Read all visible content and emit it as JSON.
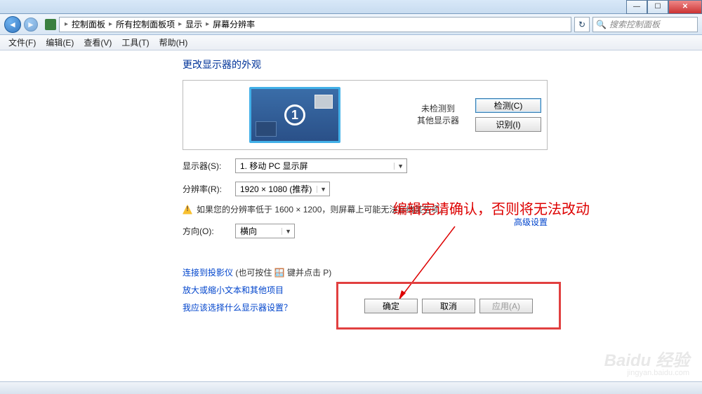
{
  "window": {
    "min_icon": "—",
    "max_icon": "☐",
    "close_icon": "✕"
  },
  "breadcrumb": {
    "items": [
      "控制面板",
      "所有控制面板项",
      "显示",
      "屏幕分辨率"
    ]
  },
  "search": {
    "placeholder": "搜索控制面板"
  },
  "menu": {
    "file": "文件(F)",
    "edit": "编辑(E)",
    "view": "查看(V)",
    "tools": "工具(T)",
    "help": "帮助(H)"
  },
  "page": {
    "heading": "更改显示器的外观",
    "monitor_number": "1",
    "not_detected_line1": "未检测到",
    "not_detected_line2": "其他显示器",
    "detect_btn": "检测(C)",
    "identify_btn": "识别(I)",
    "display_label": "显示器(S):",
    "display_value": "1. 移动 PC 显示屏",
    "resolution_label": "分辨率(R):",
    "resolution_value": "1920 × 1080 (推荐)",
    "warning_text": "如果您的分辨率低于 1600 × 1200，则屏幕上可能无法容纳某些项。",
    "orientation_label": "方向(O):",
    "orientation_value": "横向",
    "advanced_link": "高级设置",
    "projector_link": "连接到投影仪",
    "projector_paren": " (也可按住 🪟 键并点击 P)",
    "zoom_link": "放大或缩小文本和其他项目",
    "which_link": "我应该选择什么显示器设置？",
    "ok_btn": "确定",
    "cancel_btn": "取消",
    "apply_btn": "应用(A)"
  },
  "annotation": "编辑完请确认，否则将无法改动",
  "watermark": {
    "main": "Baidu 经验",
    "sub": "jingyan.baidu.com"
  }
}
